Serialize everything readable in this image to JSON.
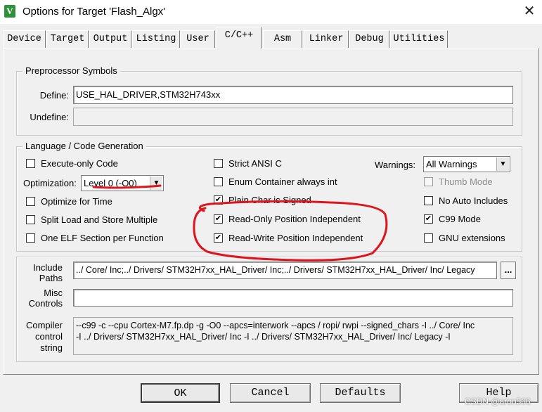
{
  "window": {
    "title": "Options for Target 'Flash_Algx'",
    "app_icon_glyph": "V"
  },
  "tabs": [
    "Device",
    "Target",
    "Output",
    "Listing",
    "User",
    "C/C++",
    "Asm",
    "Linker",
    "Debug",
    "Utilities"
  ],
  "active_tab": "C/C++",
  "preprocessor": {
    "legend": "Preprocessor Symbols",
    "define_label": "Define:",
    "define_value": "USE_HAL_DRIVER,STM32H743xx",
    "undefine_label": "Undefine:",
    "undefine_value": ""
  },
  "language": {
    "legend": "Language / Code Generation",
    "execute_only": {
      "label": "Execute-only Code",
      "checked": false
    },
    "optimization_label": "Optimization:",
    "optimization_value": "Level 0 (-O0)",
    "optimize_time": {
      "label": "Optimize for Time",
      "checked": false
    },
    "split_load": {
      "label": "Split Load and Store Multiple",
      "checked": false
    },
    "one_elf": {
      "label": "One ELF Section per Function",
      "checked": false
    },
    "strict_ansi": {
      "label": "Strict ANSI C",
      "checked": false
    },
    "enum_container": {
      "label": "Enum Container always int",
      "checked": false
    },
    "plain_char": {
      "label": "Plain Char is Signed",
      "checked": true
    },
    "ropi": {
      "label": "Read-Only Position Independent",
      "checked": true
    },
    "rwpi": {
      "label": "Read-Write Position Independent",
      "checked": true
    },
    "warnings_label": "Warnings:",
    "warnings_value": "All Warnings",
    "thumb_mode": {
      "label": "Thumb Mode",
      "checked": false,
      "disabled": true
    },
    "no_auto_includes": {
      "label": "No Auto Includes",
      "checked": false
    },
    "c99_mode": {
      "label": "C99 Mode",
      "checked": true
    },
    "gnu_ext": {
      "label": "GNU extensions",
      "checked": false
    }
  },
  "include_paths": {
    "label_line1": "Include",
    "label_line2": "Paths",
    "value": "../ Core/ Inc;../ Drivers/ STM32H7xx_HAL_Driver/ Inc;../ Drivers/ STM32H7xx_HAL_Driver/ Inc/ Legacy",
    "browse_label": "..."
  },
  "misc_controls": {
    "label_line1": "Misc",
    "label_line2": "Controls",
    "value": ""
  },
  "compiler_control": {
    "label_line1": "Compiler",
    "label_line2": "control",
    "label_line3": "string",
    "line1": "--c99 -c --cpu Cortex-M7.fp.dp -g -O0 --apcs=interwork --apcs / ropi/ rwpi --signed_chars -I ../ Core/ Inc",
    "line2": "-I ../ Drivers/ STM32H7xx_HAL_Driver/ Inc -I ../ Drivers/ STM32H7xx_HAL_Driver/ Inc/ Legacy -I"
  },
  "buttons": {
    "ok": "OK",
    "cancel": "Cancel",
    "defaults": "Defaults",
    "help": "Help"
  },
  "watermark": "CSDN @aron566",
  "colors": {
    "annotation_red": "#e0141e",
    "window_bg": "#f0f0f0"
  }
}
